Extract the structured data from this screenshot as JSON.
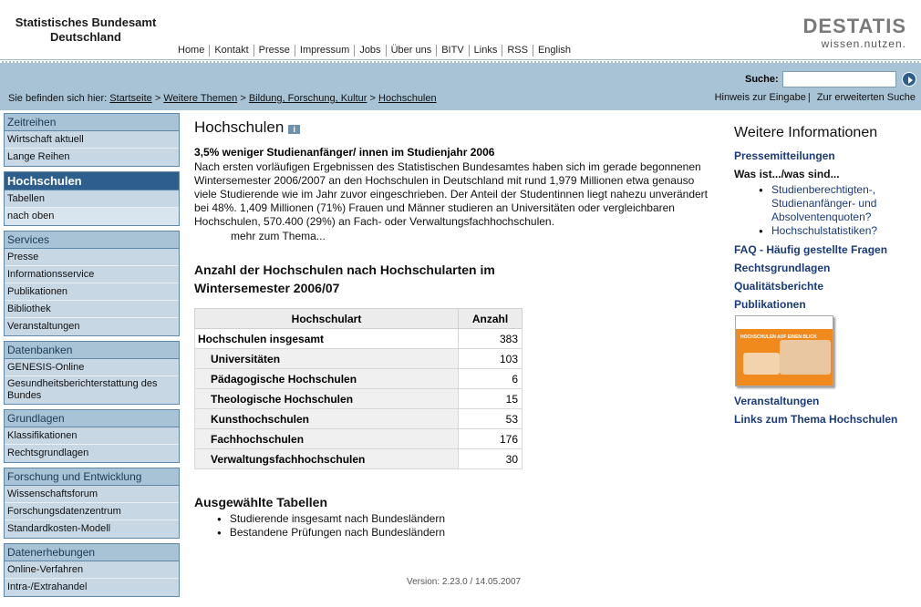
{
  "header": {
    "org_line1": "Statistisches Bundesamt",
    "org_line2": "Deutschland",
    "brand": "DESTATIS",
    "tagline": "wissen.nutzen.",
    "nav": [
      "Home",
      "Kontakt",
      "Presse",
      "Impressum",
      "Jobs",
      "Über uns",
      "BITV",
      "Links",
      "RSS",
      "English"
    ]
  },
  "breadcrumb": {
    "prefix": "Sie befinden sich hier:",
    "items": [
      "Startseite",
      "Weitere Themen",
      "Bildung, Forschung, Kultur",
      "Hochschulen"
    ],
    "sep": ">"
  },
  "search": {
    "label": "Suche:",
    "value": "",
    "hint": "Hinweis zur Eingabe",
    "advanced": "Zur erweiterten Suche"
  },
  "sidebar": [
    {
      "title": "Zeitreihen",
      "items": [
        "Wirtschaft aktuell",
        "Lange Reihen"
      ]
    },
    {
      "title": "Hochschulen",
      "items": [
        "Tabellen",
        "nach oben"
      ]
    },
    {
      "title": "Services",
      "items": [
        "Presse",
        "Informationsservice",
        "Publikationen",
        "Bibliothek",
        "Veranstaltungen"
      ]
    },
    {
      "title": "Datenbanken",
      "items": [
        "GENESIS-Online",
        "Gesundheitsberichterstattung des Bundes"
      ]
    },
    {
      "title": "Grundlagen",
      "items": [
        "Klassifikationen",
        "Rechtsgrundlagen"
      ]
    },
    {
      "title": "Forschung und Entwicklung",
      "items": [
        "Wissenschaftsforum",
        "Forschungsdatenzentrum",
        "Standardkosten-Modell"
      ]
    },
    {
      "title": "Datenerhebungen",
      "items": [
        "Online-Verfahren",
        "Intra-/Extrahandel"
      ]
    }
  ],
  "main": {
    "title": "Hochschulen",
    "info_icon": "i",
    "news_head": "3,5% weniger Studienanfänger/ innen im Studienjahr 2006",
    "news_body": "Nach ersten vorläufigen Ergebnissen des Statistischen Bundesamtes haben sich im gerade begonnenen Wintersemester 2006/2007 an den Hochschulen in Deutschland mit rund 1,979 Millionen etwa genauso viele Studierende wie im Jahr zuvor eingeschrieben. Der Anteil der Studentinnen liegt nahezu unverändert bei 48%. 1,409 Millionen (71%) Frauen und Männer studieren an Universitäten oder vergleichbaren Hochschulen, 570.400 (29%) an Fach- oder Verwaltungsfachhochschulen.",
    "more": "mehr zum Thema...",
    "table_title_1": "Anzahl der Hochschulen nach Hochschularten im",
    "table_title_2": "Wintersemester 2006/07",
    "table": {
      "headers": [
        "Hochschulart",
        "Anzahl"
      ],
      "rows": [
        {
          "label": "Hochschulen insgesamt",
          "value": "383"
        },
        {
          "label": "Universitäten",
          "value": "103"
        },
        {
          "label": "Pädagogische Hochschulen",
          "value": "6"
        },
        {
          "label": "Theologische Hochschulen",
          "value": "15"
        },
        {
          "label": "Kunsthochschulen",
          "value": "53"
        },
        {
          "label": "Fachhochschulen",
          "value": "176"
        },
        {
          "label": "Verwaltungsfachhochschulen",
          "value": "30"
        }
      ]
    },
    "selected_title": "Ausgewählte Tabellen",
    "selected": [
      "Studierende insgesamt nach Bundesländern",
      "Bestandene Prüfungen nach Bundesländern"
    ],
    "version": "Version: 2.23.0 / 14.05.2007"
  },
  "right": {
    "title": "Weitere Informationen",
    "press": "Pressemitteilungen",
    "was_ist": "Was ist.../was sind...",
    "was_items": [
      "Studienberechtigten-, Studienanfänger- und Absolventenquoten?",
      "Hochschulstatistiken?"
    ],
    "links": [
      "FAQ - Häufig gestellte Fragen",
      "Rechtsgrundlagen",
      "Qualitätsberichte",
      "Publikationen"
    ],
    "brochure_title": "HOCHSCHULEN AUF EINEN BLICK",
    "links2": [
      "Veranstaltungen",
      "Links zum Thema Hochschulen"
    ]
  },
  "colors": {
    "band": "#a9c3d6",
    "active": "#2d5e8c",
    "link": "#1a3a7a",
    "brochure": "#f08a1c"
  }
}
